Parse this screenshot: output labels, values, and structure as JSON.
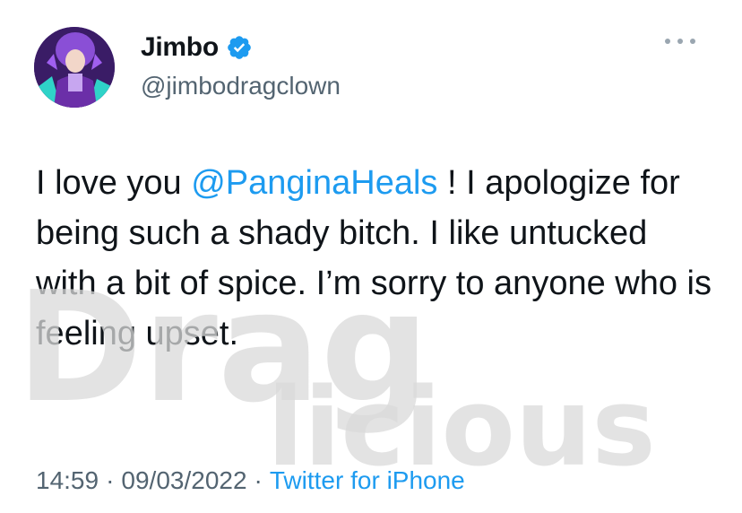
{
  "user": {
    "display_name": "Jimbo",
    "handle": "@jimbodragclown",
    "verified_icon": "verified-badge-icon",
    "verified_color": "#1d9bf0"
  },
  "tweet": {
    "text_before": "I love you ",
    "mention": "@PanginaHeals",
    "text_after": " ! I apologize for being such a shady bitch.  I like untucked with a bit of spice.  I’m sorry to anyone who is feeling upset."
  },
  "meta": {
    "time": "14:59",
    "separator": "·",
    "date": "09/03/2022",
    "source": "Twitter for iPhone"
  },
  "watermark": {
    "text_top": "Drag",
    "text_bottom": "licious"
  },
  "colors": {
    "text": "#0f1419",
    "secondary": "#536471",
    "link": "#1d9bf0",
    "watermark": "#d9d9d9"
  }
}
